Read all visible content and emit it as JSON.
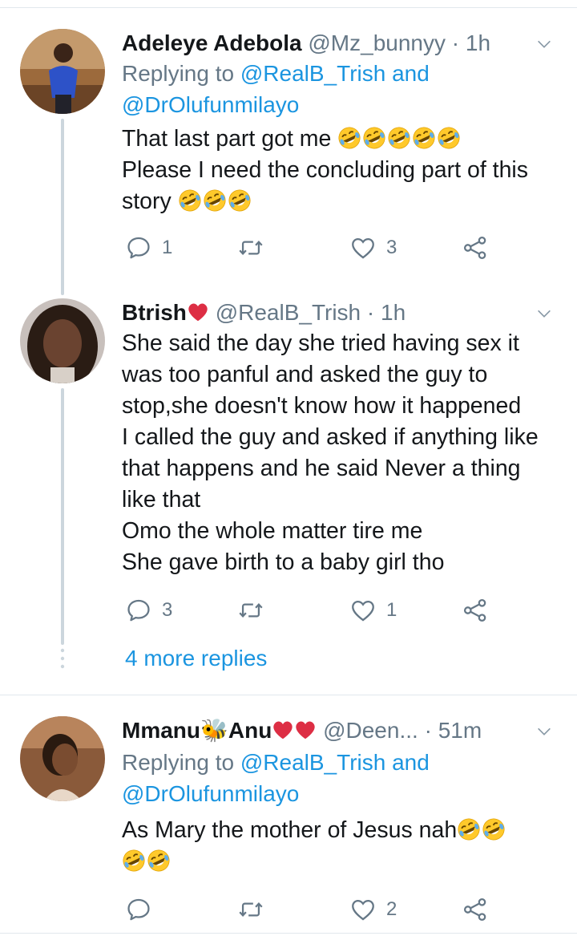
{
  "tweets": [
    {
      "name": "Adeleye Adebola",
      "handle": "@Mz_bunnyy",
      "time": "1h",
      "replying_prefix": "Replying to ",
      "replying_mention1": "@RealB_Trish",
      "replying_and": " and",
      "replying_mention2": "@DrOlufunmilayo",
      "line1": "That last part got me ",
      "line2": "Please I need the concluding part of this",
      "line3": "story ",
      "reply_count": "1",
      "retweet_count": "",
      "like_count": "3"
    },
    {
      "name": "Btrish",
      "handle": "@RealB_Trish",
      "time": "1h",
      "lines": [
        "She said the day she tried having sex it",
        "was too panful and asked the guy to",
        "stop,she doesn't know how it happened",
        "I called the guy and asked if anything like",
        "that happens and he said Never a thing",
        "like that",
        "Omo the whole matter tire me",
        "She gave birth to a baby girl tho"
      ],
      "reply_count": "3",
      "retweet_count": "",
      "like_count": "1"
    },
    {
      "name_part1": "Mmanu",
      "name_part2": "Anu",
      "handle": "@Deen...",
      "time": "51m",
      "replying_prefix": "Replying to ",
      "replying_mention1": "@RealB_Trish",
      "replying_and": " and",
      "replying_mention2": "@DrOlufunmilayo",
      "line1": "As Mary the mother of Jesus nah",
      "reply_count": "",
      "retweet_count": "",
      "like_count": "2"
    }
  ],
  "more_replies": "4 more replies",
  "icons": {
    "emoji": "rolling-on-floor-laughing",
    "reply": "reply-icon",
    "retweet": "retweet-icon",
    "like": "heart-icon",
    "share": "share-icon"
  },
  "colors": {
    "link": "#1b95e0",
    "secondary": "#657786",
    "divider": "#e1e8ed"
  }
}
